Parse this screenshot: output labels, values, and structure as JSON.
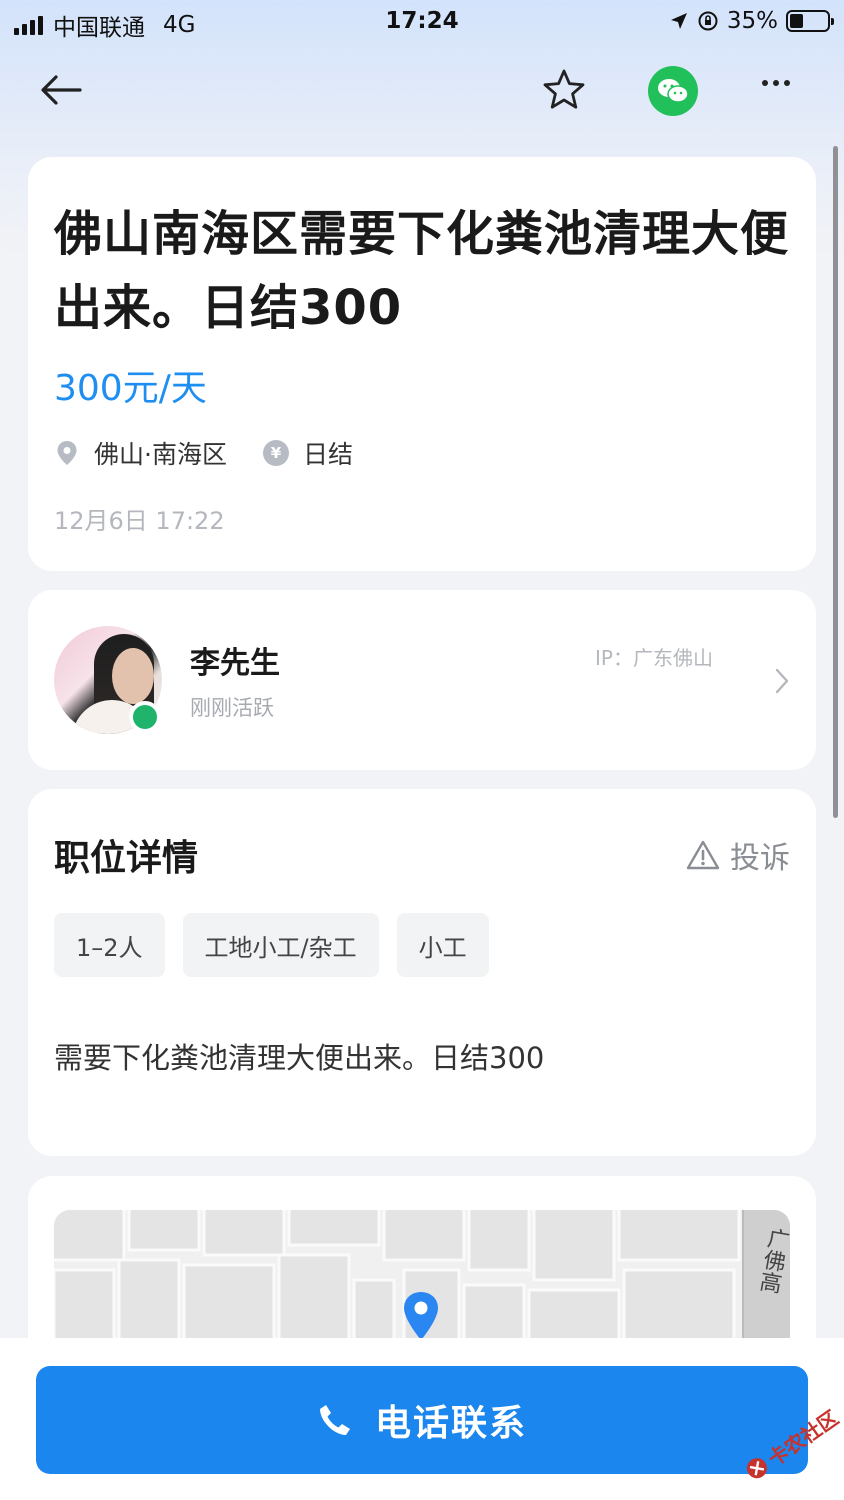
{
  "status_bar": {
    "carrier": "中国联通",
    "network": "4G",
    "time": "17:24",
    "battery": "35%",
    "battery_level": 0.35
  },
  "nav": {
    "icons": [
      "back-arrow-icon",
      "star-icon",
      "wechat-icon",
      "more-icon"
    ]
  },
  "job": {
    "title": "佛山南海区需要下化粪池清理大便出来。日结300",
    "salary": "300元/天",
    "location": "佛山·南海区",
    "settlement": "日结",
    "posted_time": "12月6日 17:22"
  },
  "employer": {
    "name": "李先生",
    "status": "刚刚活跃",
    "ip": "IP：广东佛山"
  },
  "detail": {
    "title": "职位详情",
    "report_label": "投诉",
    "tags": [
      "1–2人",
      "工地小工/杂工",
      "小工"
    ],
    "description": "需要下化粪池清理大便出来。日结300"
  },
  "map": {
    "road_label": "广佛高"
  },
  "bottom": {
    "call_label": "电话联系"
  },
  "watermark": {
    "text": "卡农社区"
  },
  "colors": {
    "accent": "#1b86ee",
    "salary": "#1e8ef0",
    "online": "#1fb36b",
    "wechat": "#21c05a"
  }
}
